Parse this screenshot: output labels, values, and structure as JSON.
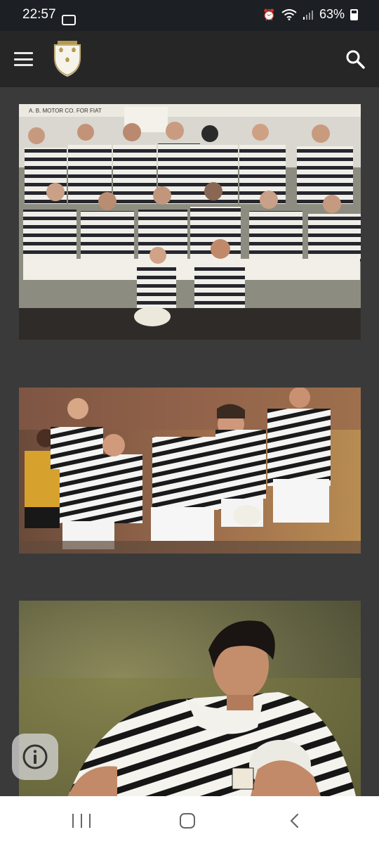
{
  "status_bar": {
    "time": "22:57",
    "battery_percent": "63%",
    "icons": [
      "notification-icon",
      "alarm-icon",
      "wifi-icon",
      "signal-icon",
      "battery-icon"
    ]
  },
  "app_bar": {
    "icons": [
      "menu-icon",
      "club-crest-logo",
      "search-icon"
    ]
  },
  "feed": {
    "photos": [
      {
        "banner_text": "A. B. MOTOR CO. FOR FIAT"
      },
      {
        "banner_text": ""
      },
      {
        "banner_text": ""
      }
    ]
  },
  "info_button": {
    "icon": "info-icon"
  },
  "nav_bar": {
    "icons": [
      "recents-icon",
      "home-icon",
      "back-icon"
    ]
  },
  "colors": {
    "background": "#3a3a3a",
    "app_bar": "#262626",
    "status_bar": "#1c1f24",
    "nav_bar": "#ffffff",
    "kit_black": "#1b1b1b",
    "kit_white": "#f2f2f2"
  }
}
